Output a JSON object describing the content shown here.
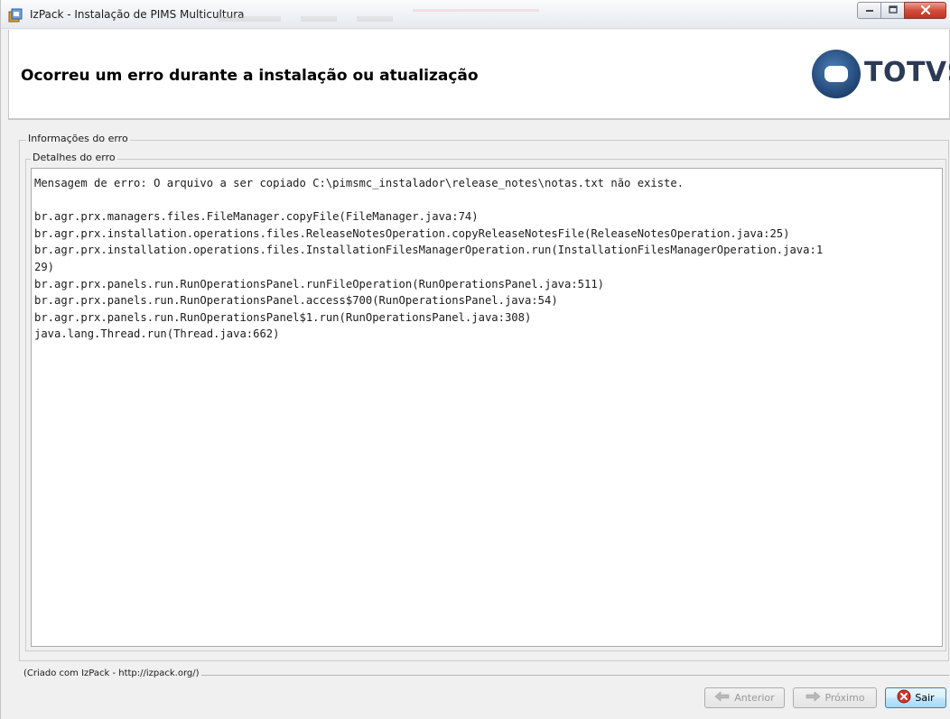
{
  "window": {
    "title": "IzPack - Instalação de PIMS Multicultura",
    "controls": {
      "minimize_icon": "minimize-icon",
      "maximize_icon": "maximize-icon",
      "close_icon": "close-icon"
    }
  },
  "header": {
    "title": "Ocorreu um erro durante a instalação ou atualização",
    "logo_text": "TOTVS"
  },
  "error_group": {
    "legend": "Informações do erro",
    "details_legend": "Detalhes do erro",
    "lines": [
      "Mensagem de erro: O arquivo a ser copiado C:\\pimsmc_instalador\\release_notes\\notas.txt não existe.",
      "",
      "br.agr.prx.managers.files.FileManager.copyFile(FileManager.java:74)",
      "br.agr.prx.installation.operations.files.ReleaseNotesOperation.copyReleaseNotesFile(ReleaseNotesOperation.java:25)",
      "br.agr.prx.installation.operations.files.InstallationFilesManagerOperation.run(InstallationFilesManagerOperation.java:1",
      "29)",
      "br.agr.prx.panels.run.RunOperationsPanel.runFileOperation(RunOperationsPanel.java:511)",
      "br.agr.prx.panels.run.RunOperationsPanel.access$700(RunOperationsPanel.java:54)",
      "br.agr.prx.panels.run.RunOperationsPanel$1.run(RunOperationsPanel.java:308)",
      "java.lang.Thread.run(Thread.java:662)"
    ]
  },
  "footer": {
    "credit": "(Criado com IzPack - http://izpack.org/)",
    "buttons": {
      "previous": "Anterior",
      "next": "Próximo",
      "quit": "Sair"
    }
  }
}
